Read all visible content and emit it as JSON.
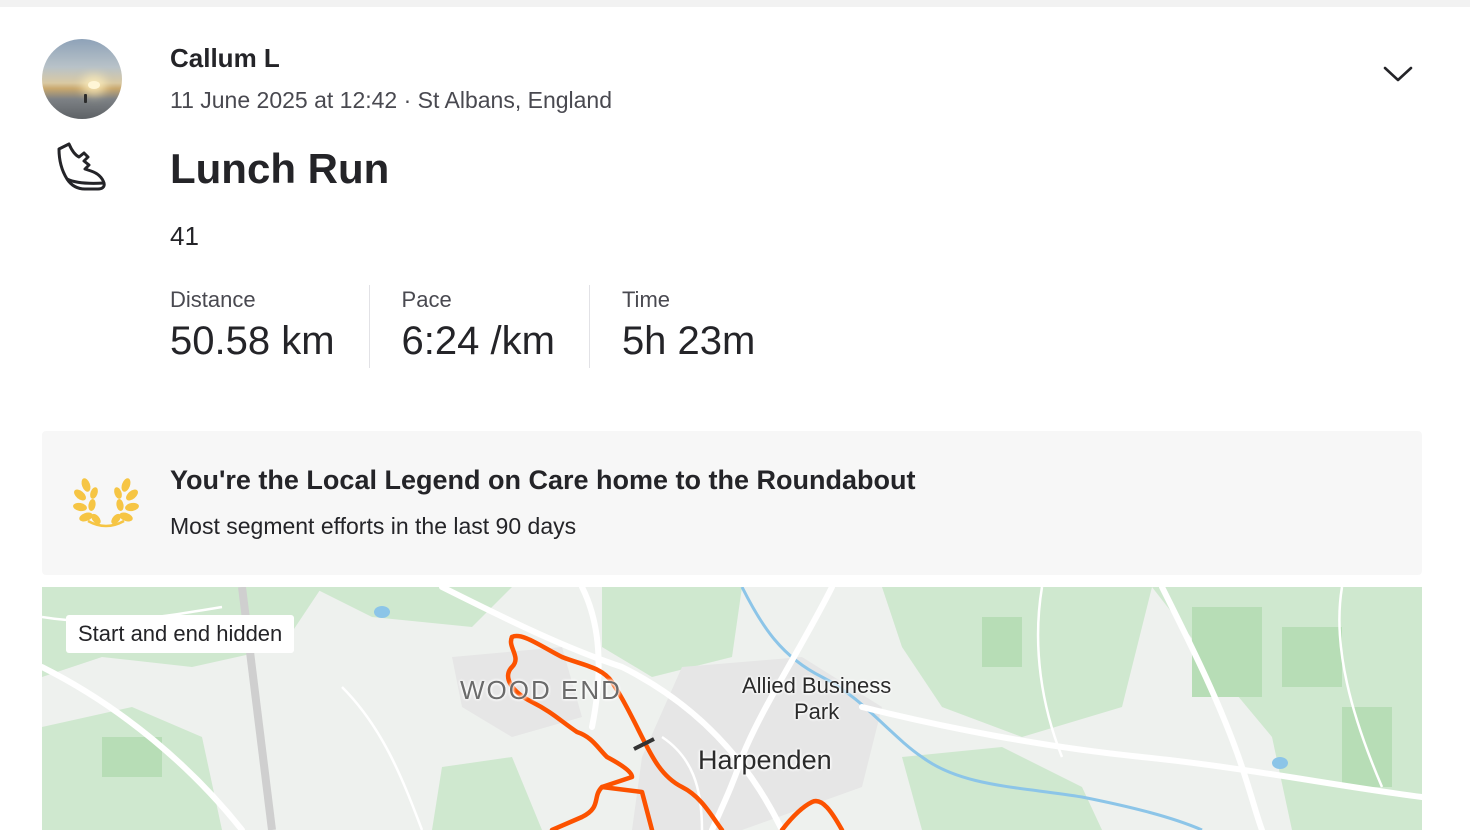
{
  "athlete": {
    "name": "Callum L",
    "meta": "11 June 2025 at 12:42 · St Albans, England"
  },
  "activity": {
    "type_icon": "running-shoe-icon",
    "title": "Lunch Run",
    "description": "41"
  },
  "stats": [
    {
      "label": "Distance",
      "value": "50.58 km"
    },
    {
      "label": "Pace",
      "value": "6:24 /km"
    },
    {
      "label": "Time",
      "value": "5h 23m"
    }
  ],
  "achievement": {
    "icon": "laurel-icon",
    "title": "You're the Local Legend on Care home to the Roundabout",
    "subtitle": "Most segment efforts in the last 90 days",
    "color": "#f6c544"
  },
  "map": {
    "privacy_chip": "Start and end hidden",
    "labels": {
      "wood_end": "WOOD END",
      "allied_business_park": "Allied Business\nPark",
      "harpenden": "Harpenden"
    },
    "route_color": "#fc5200"
  },
  "menu": {
    "icon": "chevron-down-icon"
  }
}
